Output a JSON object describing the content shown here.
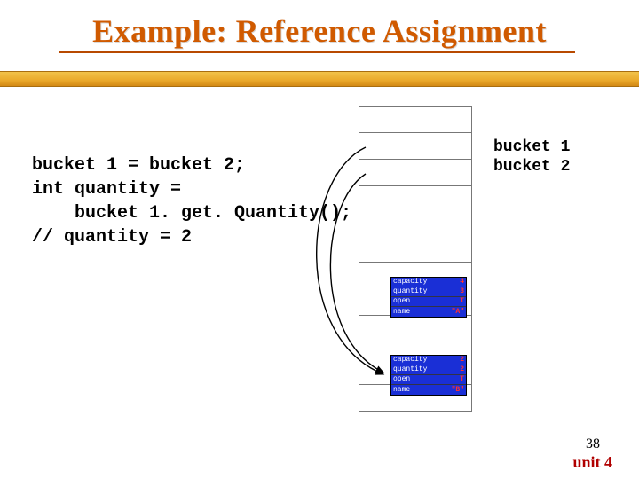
{
  "title": "Example: Reference Assignment",
  "code": {
    "line1": "bucket 1 = bucket 2;",
    "line2": "int quantity =",
    "line3": "    bucket 1. get. Quantity();",
    "line4": "// quantity = 2"
  },
  "vars": {
    "bucket1": "bucket 1",
    "bucket2": "bucket 2"
  },
  "object1": {
    "capacity_label": "capacity",
    "capacity_value": "4",
    "quantity_label": "quantity",
    "quantity_value": "3",
    "open_label": "open",
    "open_value": "T",
    "name_label": "name",
    "name_value": "\"A\""
  },
  "object2": {
    "capacity_label": "capacity",
    "capacity_value": "2",
    "quantity_label": "quantity",
    "quantity_value": "2",
    "open_label": "open",
    "open_value": "T",
    "name_label": "name",
    "name_value": "\"B\""
  },
  "footer": {
    "page": "38",
    "unit": "unit 4"
  }
}
